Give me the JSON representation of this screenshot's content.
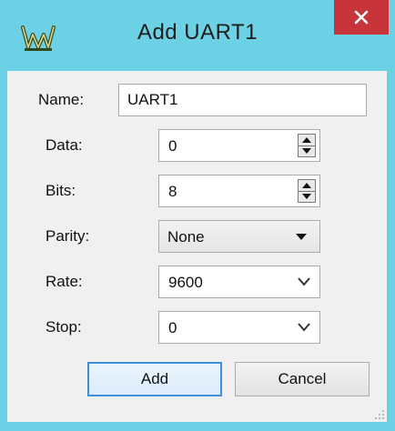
{
  "window": {
    "title": "Add UART1",
    "colors": {
      "frame": "#6dd1e5",
      "close": "#c7343a",
      "client": "#f0f0f0"
    },
    "app_icon": "app-logo-icon",
    "close_icon": "close-icon"
  },
  "form": {
    "name": {
      "label": "Name:",
      "value": "UART1"
    },
    "data": {
      "label": "Data:",
      "value": "0"
    },
    "bits": {
      "label": "Bits:",
      "value": "8"
    },
    "parity": {
      "label": "Parity:",
      "value": "None"
    },
    "rate": {
      "label": "Rate:",
      "value": "9600"
    },
    "stop": {
      "label": "Stop:",
      "value": "0"
    }
  },
  "buttons": {
    "add_label": "Add",
    "cancel_label": "Cancel"
  }
}
